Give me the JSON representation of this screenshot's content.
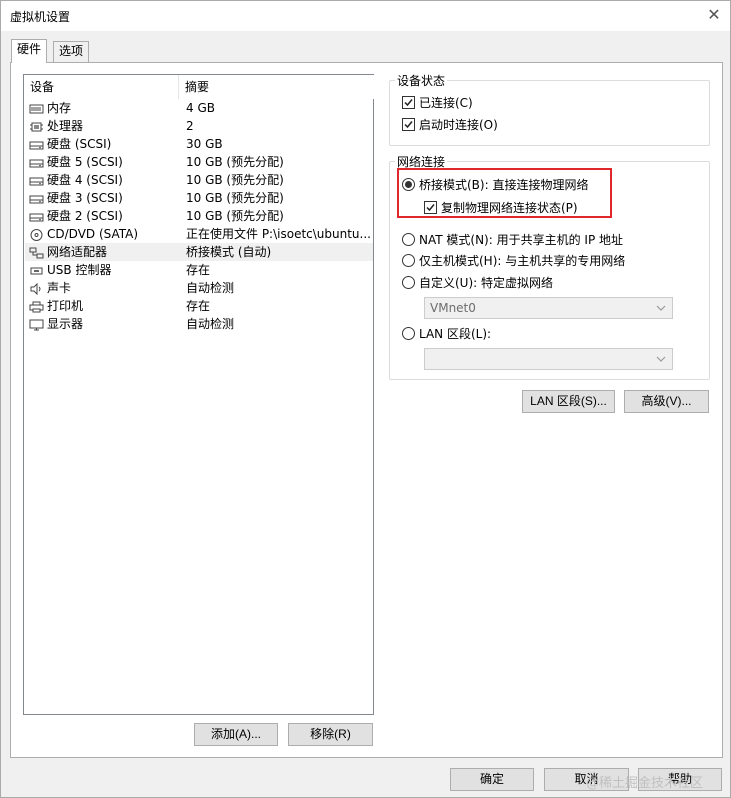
{
  "window": {
    "title": "虚拟机设置"
  },
  "tabs": [
    {
      "label": "硬件",
      "active": true
    },
    {
      "label": "选项",
      "active": false
    }
  ],
  "device_table": {
    "columns": [
      "设备",
      "摘要"
    ],
    "rows": [
      {
        "icon": "memory-icon",
        "name": "内存",
        "summary": "4 GB"
      },
      {
        "icon": "cpu-icon",
        "name": "处理器",
        "summary": "2"
      },
      {
        "icon": "disk-icon",
        "name": "硬盘 (SCSI)",
        "summary": "30 GB"
      },
      {
        "icon": "disk-icon",
        "name": "硬盘 5 (SCSI)",
        "summary": "10 GB (预先分配)"
      },
      {
        "icon": "disk-icon",
        "name": "硬盘 4 (SCSI)",
        "summary": "10 GB (预先分配)"
      },
      {
        "icon": "disk-icon",
        "name": "硬盘 3 (SCSI)",
        "summary": "10 GB (预先分配)"
      },
      {
        "icon": "disk-icon",
        "name": "硬盘 2 (SCSI)",
        "summary": "10 GB (预先分配)"
      },
      {
        "icon": "cd-icon",
        "name": "CD/DVD (SATA)",
        "summary": "正在使用文件 P:\\isoetc\\ubuntu..."
      },
      {
        "icon": "network-icon",
        "name": "网络适配器",
        "summary": "桥接模式 (自动)",
        "selected": true
      },
      {
        "icon": "usb-icon",
        "name": "USB 控制器",
        "summary": "存在"
      },
      {
        "icon": "speaker-icon",
        "name": "声卡",
        "summary": "自动检测"
      },
      {
        "icon": "printer-icon",
        "name": "打印机",
        "summary": "存在"
      },
      {
        "icon": "monitor-icon",
        "name": "显示器",
        "summary": "自动检测"
      }
    ]
  },
  "list_buttons": {
    "add": "添加(A)...",
    "remove": "移除(R)"
  },
  "device_status": {
    "title": "设备状态",
    "connected": {
      "label": "已连接(C)",
      "checked": true
    },
    "connect_on_power": {
      "label": "启动时连接(O)",
      "checked": true
    }
  },
  "network": {
    "title": "网络连接",
    "bridged": {
      "label": "桥接模式(B): 直接连接物理网络",
      "selected": true
    },
    "replicate": {
      "label": "复制物理网络连接状态(P)",
      "checked": true
    },
    "nat": {
      "label": "NAT 模式(N): 用于共享主机的 IP 地址",
      "selected": false
    },
    "host_only": {
      "label": "仅主机模式(H): 与主机共享的专用网络",
      "selected": false
    },
    "custom": {
      "label": "自定义(U): 特定虚拟网络",
      "selected": false,
      "select_value": "VMnet0"
    },
    "lan": {
      "label": "LAN 区段(L):",
      "selected": false,
      "select_value": ""
    }
  },
  "network_buttons": {
    "lan_segments": "LAN 区段(S)...",
    "advanced": "高级(V)..."
  },
  "footer": {
    "ok": "确定",
    "cancel": "取消",
    "help": "帮助"
  },
  "watermark": "@稀土掘金技术社区",
  "colors": {
    "highlight": "#e0272b",
    "selected_row": "#f0f0f0"
  }
}
